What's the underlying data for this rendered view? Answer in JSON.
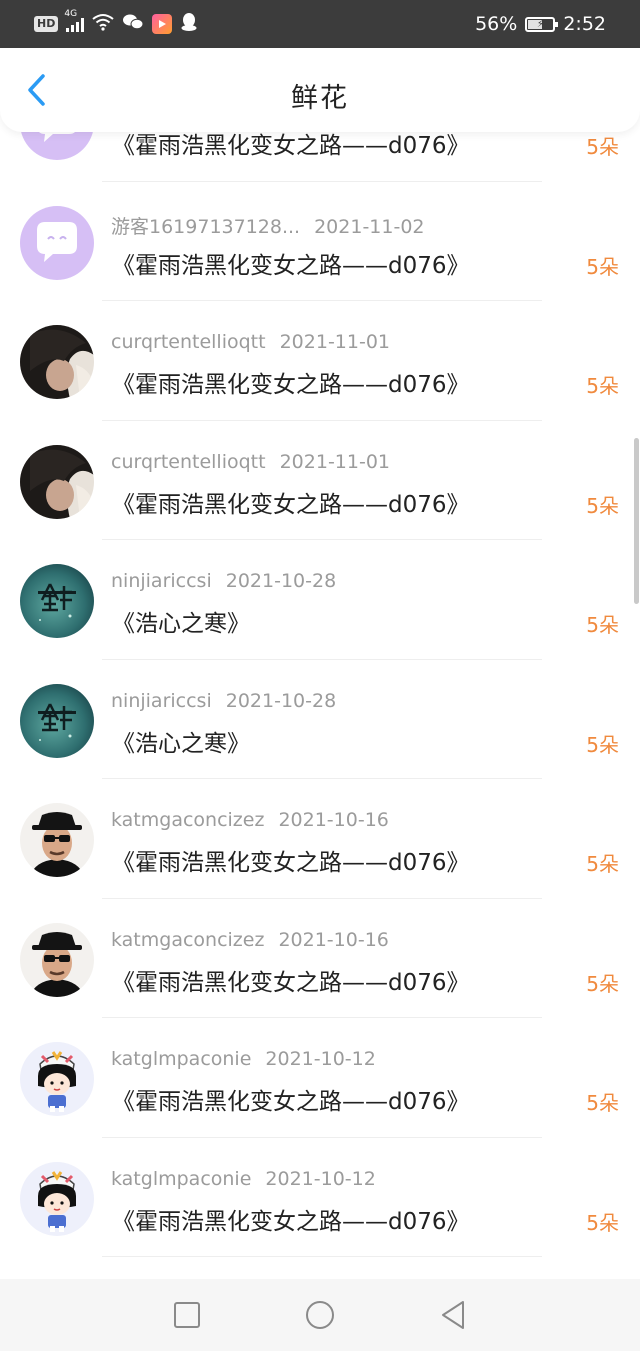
{
  "status_bar": {
    "hd": "HD",
    "network": "4G",
    "battery_percent": "56%",
    "time": "2:52",
    "battery_level": 0.56,
    "icons": [
      "hd-icon",
      "signal-icon",
      "wifi-icon",
      "wechat-icon",
      "app-icon",
      "qq-icon",
      "battery-icon"
    ]
  },
  "header": {
    "back_icon": "chevron-left-icon",
    "title": "鲜花",
    "accent_color": "#2b9bf4"
  },
  "rows": [
    {
      "user": "",
      "date": "",
      "work": "《霍雨浩黑化变女之路——d076》",
      "amount": "5朵",
      "avatar": "chat-bubble"
    },
    {
      "user": "游客16197137128...",
      "date": "2021-11-02",
      "work": "《霍雨浩黑化变女之路——d076》",
      "amount": "5朵",
      "avatar": "chat-bubble"
    },
    {
      "user": "curqrtentellioqtt",
      "date": "2021-11-01",
      "work": "《霍雨浩黑化变女之路——d076》",
      "amount": "5朵",
      "avatar": "dark-hair"
    },
    {
      "user": "curqrtentellioqtt",
      "date": "2021-11-01",
      "work": "《霍雨浩黑化变女之路——d076》",
      "amount": "5朵",
      "avatar": "dark-hair"
    },
    {
      "user": "ninjiariccsi",
      "date": "2021-10-28",
      "work": "《浩心之寒》",
      "amount": "5朵",
      "avatar": "teal-logo"
    },
    {
      "user": "ninjiariccsi",
      "date": "2021-10-28",
      "work": "《浩心之寒》",
      "amount": "5朵",
      "avatar": "teal-logo"
    },
    {
      "user": "katmgaconcizez",
      "date": "2021-10-16",
      "work": "《霍雨浩黑化变女之路——d076》",
      "amount": "5朵",
      "avatar": "hat-man"
    },
    {
      "user": "katmgaconcizez",
      "date": "2021-10-16",
      "work": "《霍雨浩黑化变女之路——d076》",
      "amount": "5朵",
      "avatar": "hat-man"
    },
    {
      "user": "katglmpaconie",
      "date": "2021-10-12",
      "work": "《霍雨浩黑化变女之路——d076》",
      "amount": "5朵",
      "avatar": "cartoon-kid"
    },
    {
      "user": "katglmpaconie",
      "date": "2021-10-12",
      "work": "《霍雨浩黑化变女之路——d076》",
      "amount": "5朵",
      "avatar": "cartoon-kid"
    }
  ],
  "colors": {
    "amount": "#f08a3e",
    "meta": "#9b9b9b",
    "status_bar": "#3c3c3c"
  },
  "navbar": {
    "icons": [
      "recent-apps-icon",
      "home-icon",
      "back-triangle-icon"
    ]
  }
}
